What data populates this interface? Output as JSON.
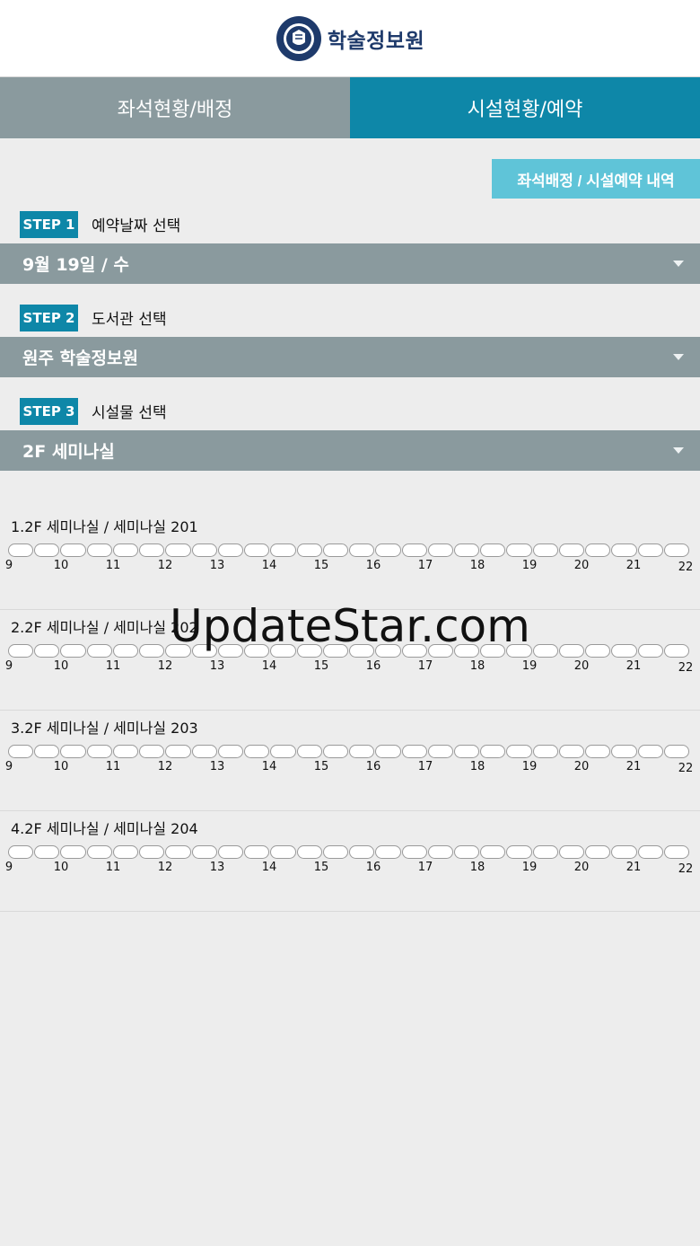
{
  "header": {
    "title": "학술정보원",
    "logo_icon": "university-emblem-icon"
  },
  "tabs": [
    {
      "label": "좌석현황/배정",
      "active": false
    },
    {
      "label": "시설현황/예약",
      "active": true
    }
  ],
  "history_button": "좌석배정 / 시설예약 내역",
  "steps": [
    {
      "badge": "STEP 1",
      "label": "예약날짜 선택",
      "selected": "9월 19일 / 수"
    },
    {
      "badge": "STEP 2",
      "label": "도서관 선택",
      "selected": "원주 학술정보원"
    },
    {
      "badge": "STEP 3",
      "label": "시설물 선택",
      "selected": "2F 세미나실"
    }
  ],
  "hours": [
    "9",
    "10",
    "11",
    "12",
    "13",
    "14",
    "15",
    "16",
    "17",
    "18",
    "19",
    "20",
    "21",
    "22"
  ],
  "rooms": [
    {
      "title": "1.2F 세미나실 / 세미나실 201"
    },
    {
      "title": "2.2F 세미나실 / 세미나실 202"
    },
    {
      "title": "3.2F 세미나실 / 세미나실 203"
    },
    {
      "title": "4.2F 세미나실 / 세미나실 204"
    }
  ],
  "watermark": "UpdateStar.com",
  "colors": {
    "accent": "#0e87a8",
    "inactive": "#8a9a9e",
    "history_button": "#5fc4d8"
  }
}
